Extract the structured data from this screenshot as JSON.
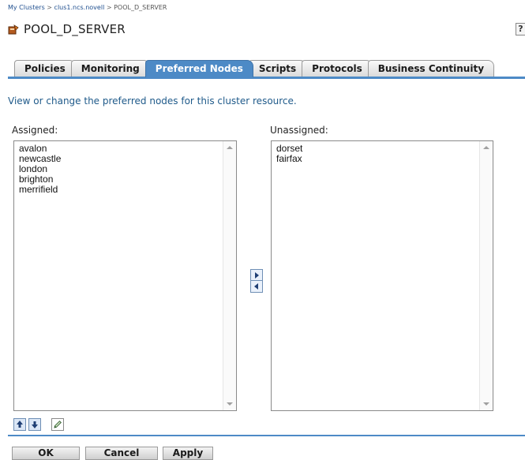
{
  "breadcrumb": {
    "items": [
      "My Clusters",
      "clus1.ncs.novell",
      "POOL_D_SERVER"
    ],
    "separator": ">"
  },
  "page": {
    "title": "POOL_D_SERVER",
    "help_label": "?"
  },
  "tabs": [
    {
      "label": "Policies",
      "active": false
    },
    {
      "label": "Monitoring",
      "active": false
    },
    {
      "label": "Preferred Nodes",
      "active": true
    },
    {
      "label": "Scripts",
      "active": false
    },
    {
      "label": "Protocols",
      "active": false
    },
    {
      "label": "Business Continuity",
      "active": false
    }
  ],
  "description": "View or change the preferred nodes for this cluster resource.",
  "assigned": {
    "label": "Assigned:",
    "items": [
      "avalon",
      "newcastle",
      "london",
      "brighton",
      "merrifield"
    ]
  },
  "unassigned": {
    "label": "Unassigned:",
    "items": [
      "dorset",
      "fairfax"
    ]
  },
  "icons": {
    "move_right": "arrow-right-icon",
    "move_left": "arrow-left-icon",
    "move_up": "arrow-up-icon",
    "move_down": "arrow-down-icon",
    "edit": "pencil-icon"
  },
  "buttons": {
    "ok": "OK",
    "cancel": "Cancel",
    "apply": "Apply"
  },
  "colors": {
    "accent": "#4d8ac6",
    "link": "#1f4f8f",
    "description": "#1f5a8a"
  }
}
